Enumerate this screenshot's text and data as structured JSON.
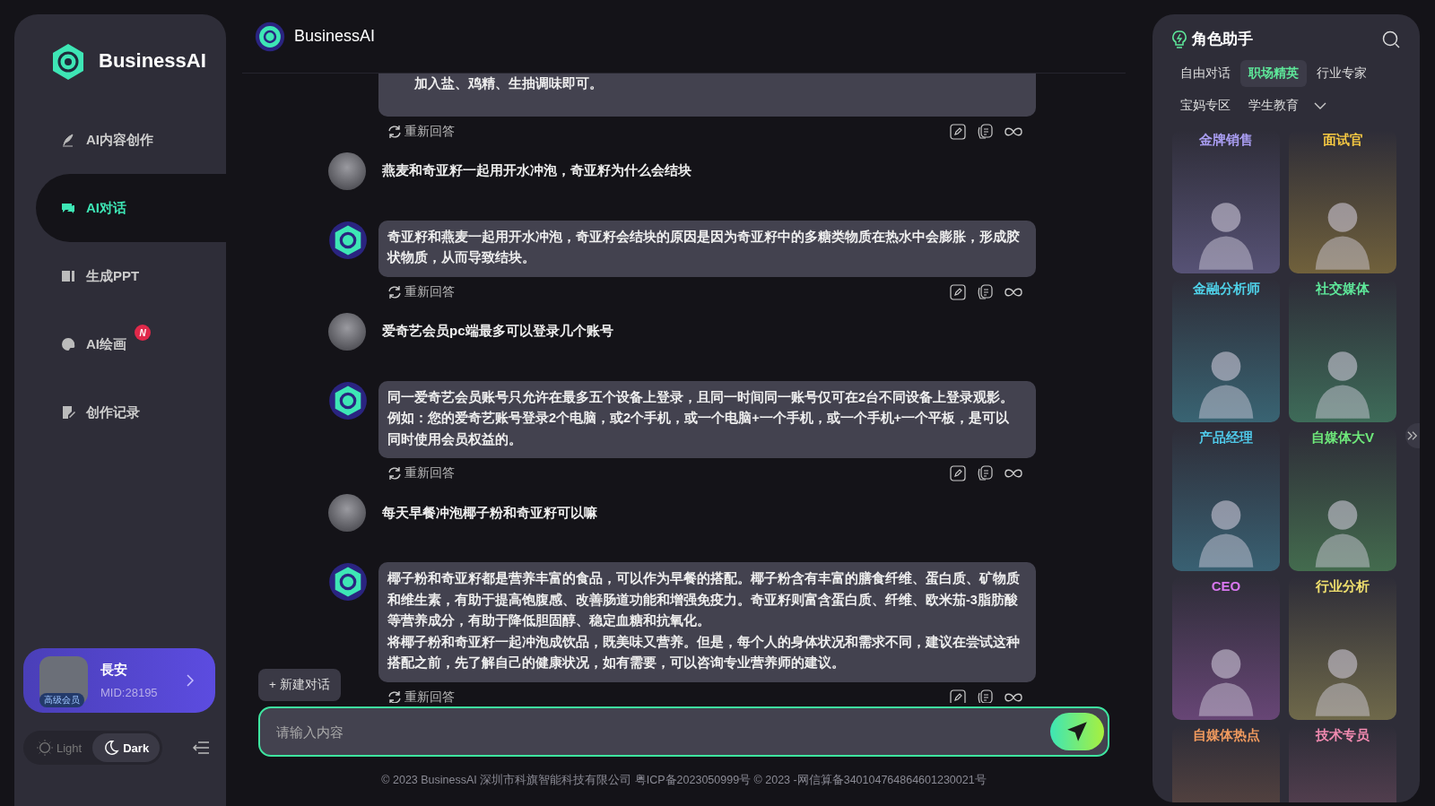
{
  "sidebar": {
    "brand": "BusinessAI",
    "nav": [
      {
        "label": "AI内容创作",
        "selected": false
      },
      {
        "label": "AI对话",
        "selected": true
      },
      {
        "label": "生成PPT",
        "selected": false
      },
      {
        "label": "AI绘画",
        "selected": false,
        "badge": "N"
      },
      {
        "label": "创作记录",
        "selected": false
      }
    ],
    "user": {
      "badge": "高级会员",
      "name": "長安",
      "mid": "MID:28195"
    },
    "theme": [
      {
        "label": "Light",
        "kind": "sun",
        "selected": false
      },
      {
        "label": "Dark",
        "kind": "moon",
        "selected": true
      }
    ]
  },
  "chat": {
    "title": "BusinessAI",
    "messages": [
      {
        "kind": "assistant-partial",
        "paragraphs": [
          "加入盐、鸡精、生抽调味即可。"
        ],
        "regenerate": "重新回答"
      },
      {
        "kind": "user",
        "text": "燕麦和奇亚籽一起用开水冲泡，奇亚籽为什么会结块"
      },
      {
        "kind": "assistant",
        "paragraphs": [
          "奇亚籽和燕麦一起用开水冲泡，奇亚籽会结块的原因是因为奇亚籽中的多糖类物质在热水中会膨胀，形成胶状物质，从而导致结块。"
        ],
        "regenerate": "重新回答"
      },
      {
        "kind": "user",
        "text": "爱奇艺会员pc端最多可以登录几个账号"
      },
      {
        "kind": "assistant",
        "paragraphs": [
          "同一爱奇艺会员账号只允许在最多五个设备上登录，且同一时间同一账号仅可在2台不同设备上登录观影。例如：您的爱奇艺账号登录2个电脑，或2个手机，或一个电脑+一个手机，或一个手机+一个平板，是可以同时使用会员权益的。"
        ],
        "regenerate": "重新回答"
      },
      {
        "kind": "user",
        "text": "每天早餐冲泡椰子粉和奇亚籽可以嘛"
      },
      {
        "kind": "assistant",
        "paragraphs": [
          "椰子粉和奇亚籽都是营养丰富的食品，可以作为早餐的搭配。椰子粉含有丰富的膳食纤维、蛋白质、矿物质和维生素，有助于提高饱腹感、改善肠道功能和增强免疫力。奇亚籽则富含蛋白质、纤维、欧米茄-3脂肪酸等营养成分，有助于降低胆固醇、稳定血糖和抗氧化。",
          "将椰子粉和奇亚籽一起冲泡成饮品，既美味又营养。但是，每个人的身体状况和需求不同，建议在尝试这种搭配之前，先了解自己的健康状况，如有需要，可以咨询专业营养师的建议。"
        ],
        "regenerate": "重新回答"
      }
    ],
    "new_chat": "+ 新建对话",
    "input": {
      "placeholder": "请输入内容"
    },
    "footer": "© 2023 BusinessAI 深圳市科旗智能科技有限公司 粤ICP备2023050999号 © 2023 -网信算备340104764864601230021号"
  },
  "roles": {
    "title": "角色助手",
    "tabs": [
      {
        "label": "自由对话",
        "selected": false
      },
      {
        "label": "职场精英",
        "selected": true
      },
      {
        "label": "行业专家",
        "selected": false
      },
      {
        "label": "宝妈专区",
        "selected": false
      },
      {
        "label": "学生教育",
        "selected": false
      }
    ],
    "cards": [
      {
        "name": "金牌销售",
        "color": "#a89cf0"
      },
      {
        "name": "面试官",
        "color": "#f5c842"
      },
      {
        "name": "金融分析师",
        "color": "#4fd1e8"
      },
      {
        "name": "社交媒体",
        "color": "#5ee89a"
      },
      {
        "name": "产品经理",
        "color": "#4fc8e8"
      },
      {
        "name": "自媒体大V",
        "color": "#6ee87a"
      },
      {
        "name": "CEO",
        "color": "#d977f0"
      },
      {
        "name": "行业分析",
        "color": "#f0e06e"
      },
      {
        "name": "自媒体热点",
        "color": "#f09a5e"
      },
      {
        "name": "技术专员",
        "color": "#f08ab0"
      }
    ]
  }
}
